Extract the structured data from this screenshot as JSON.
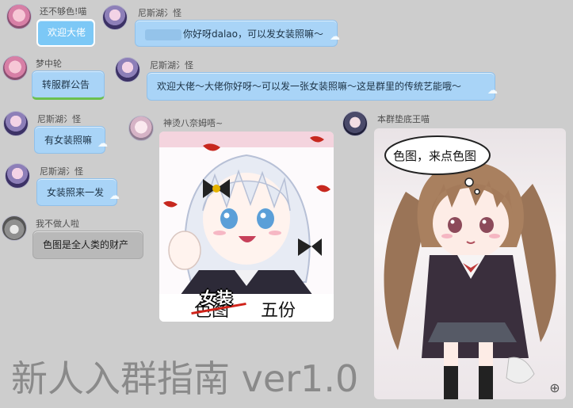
{
  "messages": [
    {
      "name": "还不够色!喵",
      "text": "欢迎大佬"
    },
    {
      "name": "尼斯湖氵怪",
      "text": "你好呀dalao，可以发女装照嘛～"
    },
    {
      "name": "梦中轮",
      "text": "转服群公告"
    },
    {
      "name": "尼斯湖氵怪",
      "text": "欢迎大佬～大佬你好呀～可以发一张女装照嘛～这是群里的传统艺能哦～"
    },
    {
      "name": "尼斯湖氵怪",
      "text": "有女装照嘛"
    },
    {
      "name": "神烫八奈姆唔~"
    },
    {
      "name": "本群垫底王喵"
    },
    {
      "name": "尼斯湖氵怪",
      "text": "女装照来一发"
    },
    {
      "name": "我不做人啦",
      "text": "色图是全人类的财产"
    }
  ],
  "images": {
    "meme_left": {
      "overlay": "女装",
      "crossed": "色图",
      "suffix": "五份"
    },
    "meme_right": {
      "speech": "色图，来点色图"
    }
  },
  "title": "新人入群指南 ver1.0",
  "colors": {
    "bubble": "#a9d4f7",
    "bubble_selected": "#7cc8f6",
    "bubble_grey": "#b9b9b9",
    "background": "#cdcdcd"
  },
  "icons": {
    "zoom": "zoom-in-icon",
    "bubble_tail": "cloud-icon"
  }
}
